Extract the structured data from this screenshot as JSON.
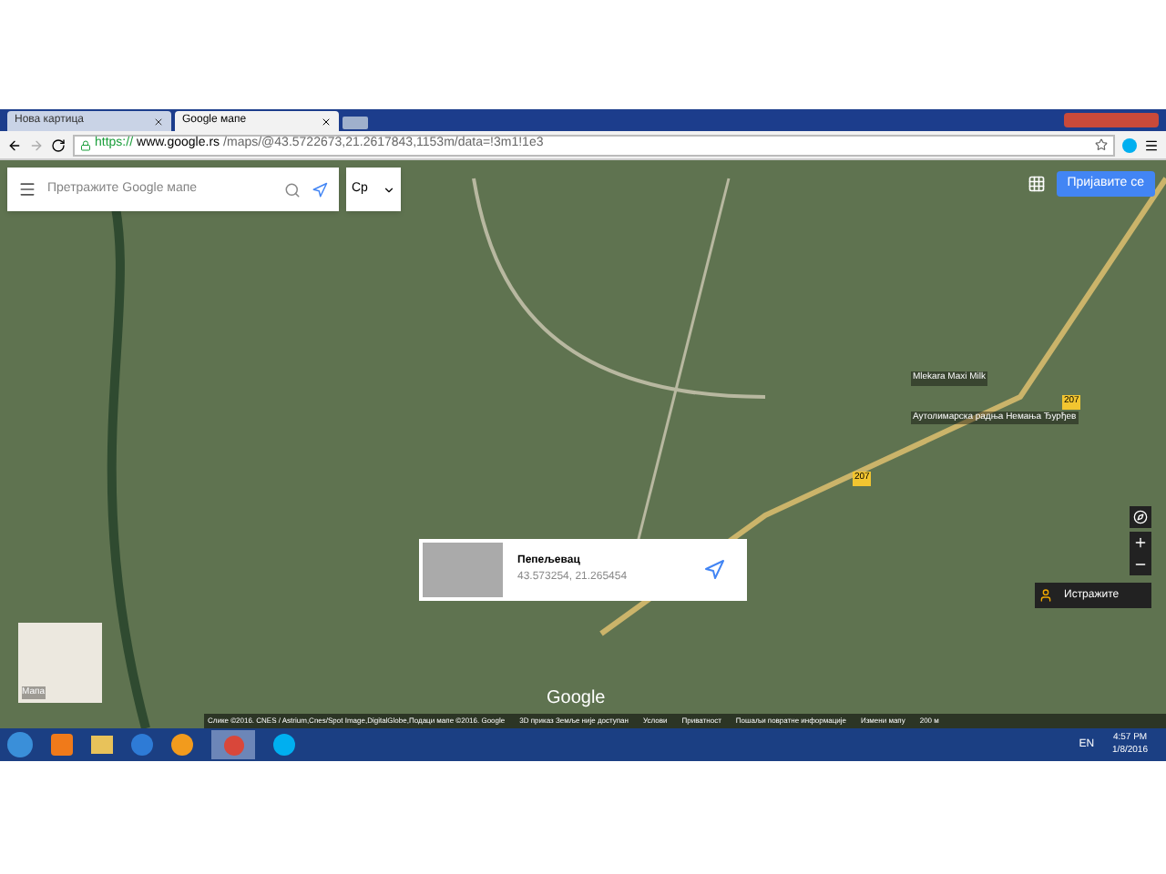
{
  "tabs": [
    {
      "label": "Нова картица",
      "selected": false
    },
    {
      "label": "Google мапе",
      "selected": true
    }
  ],
  "address_bar": {
    "scheme": "https://",
    "host": "www.google.rs",
    "path": "/maps/@43.5722673,21.2617843,1153m/data=!3m1!1e3"
  },
  "search": {
    "placeholder": "Претражите Google мапе"
  },
  "language": "Ср",
  "sign_in": "Пријавите се",
  "map_labels": [
    {
      "text": "Mlekara Maxi Milk"
    },
    {
      "text": "Аутолимарска радња Немања Ђурђев"
    }
  ],
  "road_badges": [
    "207",
    "207"
  ],
  "place_card": {
    "title": "Пепељевац",
    "coords": "43.573254, 21.265454"
  },
  "street_view": "Истражите",
  "minimap_label": "Мапа",
  "logo": "Google",
  "footer": {
    "attribution": "Слике ©2016. CNES / Astrium,Cnes/Spot Image,DigitalGlobe,Подаци мапе ©2016. Google",
    "links": [
      "3D приказ Земље није доступан",
      "Услови",
      "Приватност",
      "Пошаљи повратне информације",
      "Измени мапу"
    ],
    "scale": "200 м"
  },
  "taskbar": {
    "language": "EN",
    "time": "4:57 PM",
    "date": "1/8/2016"
  }
}
